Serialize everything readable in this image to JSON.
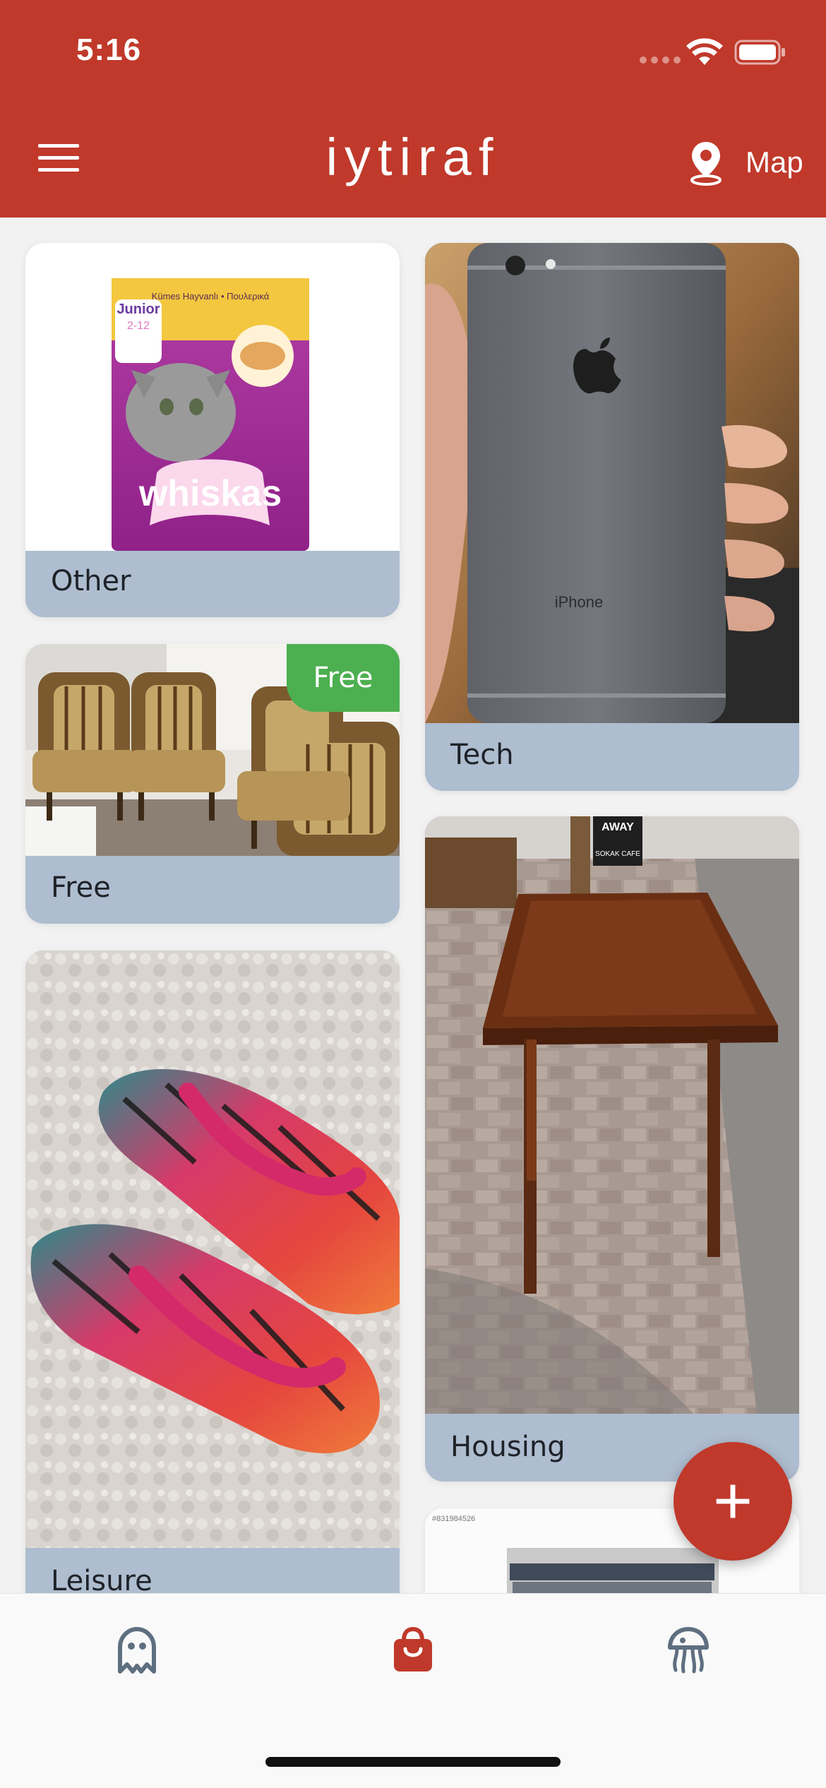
{
  "status_bar": {
    "time": "5:16"
  },
  "header": {
    "title": "iytiraf",
    "map_label": "Map",
    "brand_color": "#c0392b"
  },
  "cards": {
    "other": {
      "label": "Other"
    },
    "tech": {
      "label": "Tech"
    },
    "free": {
      "label": "Free",
      "badge": "Free"
    },
    "housing": {
      "label": "Housing"
    },
    "leisure": {
      "label": "Leisure"
    },
    "books": {
      "label": ""
    }
  },
  "image_text": {
    "whiskas_brand": "whiskas",
    "whiskas_junior": "Junior",
    "whiskas_age": "2-12",
    "whiskas_top": "Kümes Hayvanlı • Πουλερικά",
    "iphone_text": "iPhone",
    "sign_away": "AWAY",
    "sign_cafe": "SOKAK CAFE",
    "book_code": "#831984526"
  },
  "fab": {
    "symbol": "+"
  },
  "bottom_nav": {
    "items": [
      {
        "icon": "ghost-icon",
        "active": false
      },
      {
        "icon": "shopping-bag-icon",
        "active": true
      },
      {
        "icon": "jellyfish-icon",
        "active": false
      }
    ]
  },
  "colors": {
    "card_label_bg": "#aebdcf",
    "free_badge": "#4caf50",
    "accent": "#c0392b"
  }
}
